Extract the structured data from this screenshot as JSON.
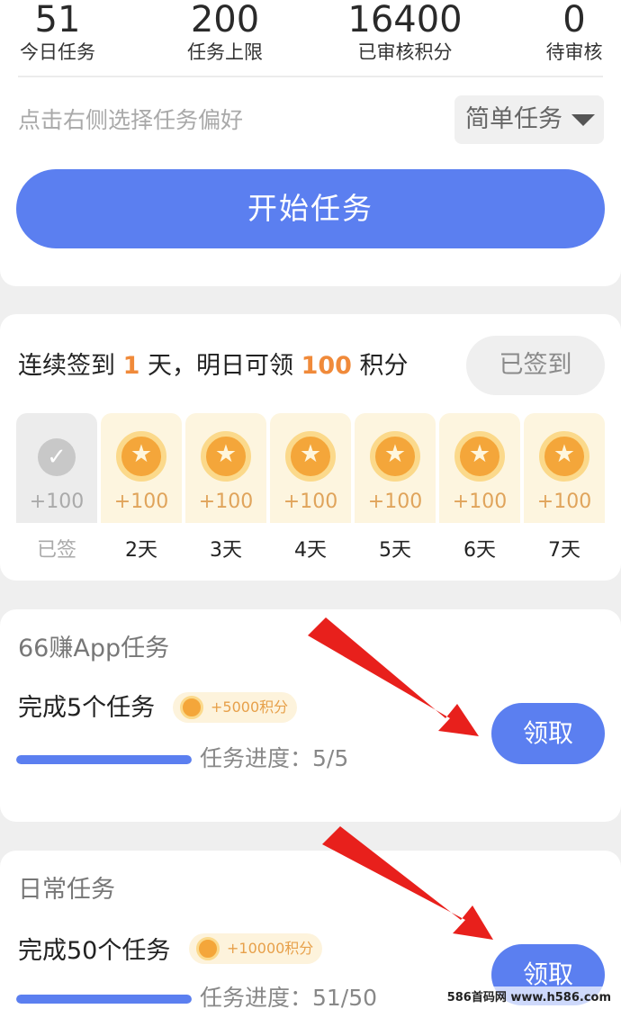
{
  "stats": [
    {
      "value": "51",
      "label": "今日任务"
    },
    {
      "value": "200",
      "label": "任务上限"
    },
    {
      "value": "16400",
      "label": "已审核积分"
    },
    {
      "value": "0",
      "label": "待审核"
    }
  ],
  "preference": {
    "hint": "点击右侧选择任务偏好",
    "selected": "简单任务"
  },
  "start_button": "开始任务",
  "sign_in": {
    "text_prefix": "连续签到 ",
    "streak_days": "1",
    "text_mid": " 天，明日可领 ",
    "tomorrow_points": "100",
    "text_suffix": " 积分",
    "button": "已签到",
    "days": [
      {
        "points": "+100",
        "label": "已签"
      },
      {
        "points": "+100",
        "label": "2天"
      },
      {
        "points": "+100",
        "label": "3天"
      },
      {
        "points": "+100",
        "label": "4天"
      },
      {
        "points": "+100",
        "label": "5天"
      },
      {
        "points": "+100",
        "label": "6天"
      },
      {
        "points": "+100",
        "label": "7天"
      }
    ]
  },
  "tasks": [
    {
      "title": "66赚App任务",
      "name": "完成5个任务",
      "reward": "+5000积分",
      "progress_text": "任务进度：5/5",
      "progress": 1.0,
      "claim": "领取"
    },
    {
      "title": "日常任务",
      "name": "完成50个任务",
      "reward": "+10000积分",
      "progress_text": "任务进度：51/50",
      "progress": 1.0,
      "claim": "领取"
    }
  ],
  "colors": {
    "accent": "#5b7ff0",
    "highlight": "#f08a3a",
    "coin": "#f4a63a",
    "arrow": "#e8201c"
  },
  "watermark": "586首码网 www.h586.com"
}
